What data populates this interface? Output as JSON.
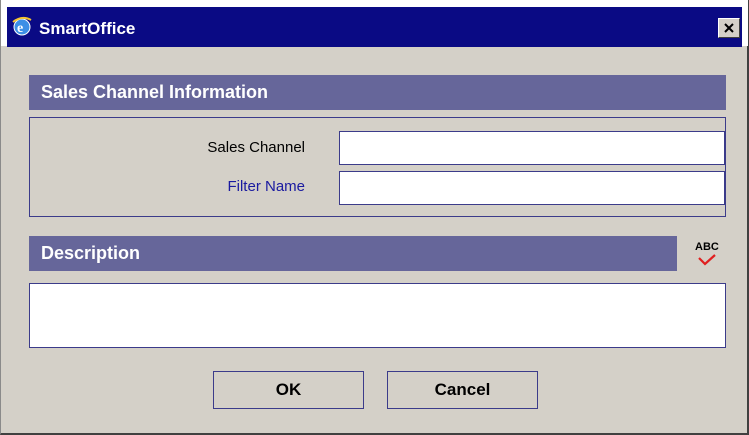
{
  "window": {
    "title": "SmartOffice"
  },
  "sales_section": {
    "header": "Sales Channel Information",
    "fields": {
      "sales_channel": {
        "label": "Sales Channel",
        "value": ""
      },
      "filter_name": {
        "label": "Filter Name",
        "value": ""
      }
    }
  },
  "description_section": {
    "header": "Description",
    "value": "",
    "spellcheck_label": "ABC"
  },
  "buttons": {
    "ok": "OK",
    "cancel": "Cancel"
  },
  "icons": {
    "app": "ie-app-icon",
    "close": "close-icon",
    "spellcheck": "spellcheck-icon"
  },
  "colors": {
    "titlebar": "#0a0a84",
    "section_header": "#66669a",
    "dialog_bg": "#d4d0c8",
    "link_label": "#1a1aa0"
  }
}
